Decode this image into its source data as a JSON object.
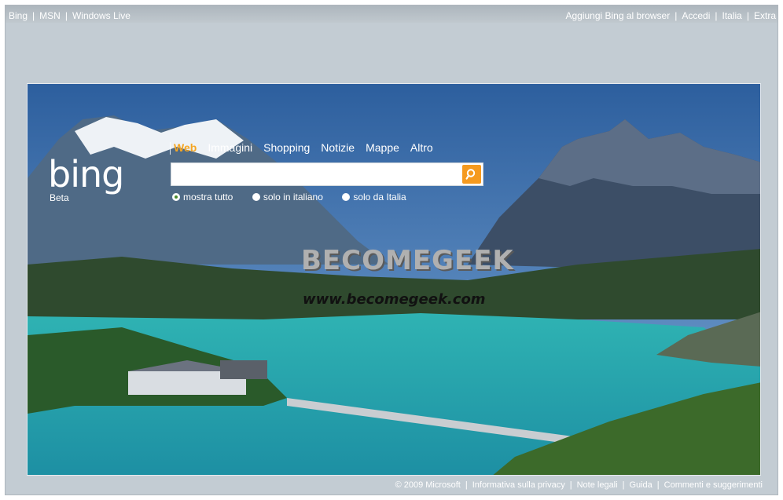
{
  "topbar": {
    "left_links": [
      "Bing",
      "MSN",
      "Windows Live"
    ],
    "right_links": [
      "Aggiungi Bing al browser",
      "Accedi",
      "Italia",
      "Extra"
    ]
  },
  "brand": {
    "logo": "bing",
    "beta": "Beta"
  },
  "nav": {
    "items": [
      "Web",
      "Immagini",
      "Shopping",
      "Notizie",
      "Mappe",
      "Altro"
    ],
    "active": "Web"
  },
  "search": {
    "value": "",
    "placeholder": ""
  },
  "scope": {
    "options": [
      "mostra tutto",
      "solo in italiano",
      "solo da Italia"
    ],
    "selected": "mostra tutto"
  },
  "watermark": {
    "title": "BECOMEGEEK",
    "url": "www.becomegeek.com"
  },
  "footer": {
    "items": [
      "© 2009 Microsoft",
      "Informativa sulla privacy",
      "Note legali",
      "Guida",
      "Commenti e suggerimenti"
    ]
  },
  "colors": {
    "accent": "#f5a623",
    "search_button": "#f59a1f",
    "frame": "#c3ccd3"
  }
}
